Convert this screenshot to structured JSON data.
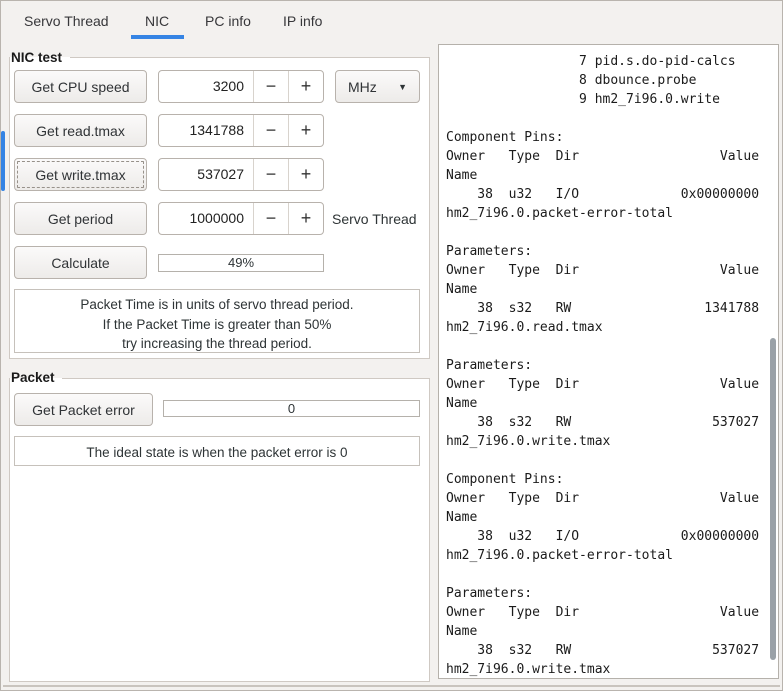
{
  "tabs": {
    "items": [
      {
        "label": "Servo Thread",
        "active": false
      },
      {
        "label": "NIC",
        "active": true
      },
      {
        "label": "PC info",
        "active": false
      },
      {
        "label": "IP info",
        "active": false
      }
    ]
  },
  "icons": {
    "minus": "−",
    "plus": "+",
    "dropdown": "▼"
  },
  "nic": {
    "title": "NIC test",
    "rows": [
      {
        "button": "Get CPU speed",
        "value": "3200",
        "unit": "MHz"
      },
      {
        "button": "Get read.tmax",
        "value": "1341788"
      },
      {
        "button": "Get write.tmax",
        "value": "537027"
      },
      {
        "button": "Get period",
        "value": "1000000",
        "side_label": "Servo Thread"
      }
    ],
    "calculate": "Calculate",
    "progress": "49%",
    "note": [
      "Packet Time is in units of servo thread period.",
      "If the Packet Time is greater than 50%",
      "try increasing the thread period."
    ]
  },
  "packet": {
    "title": "Packet",
    "button": "Get Packet error",
    "value": "0",
    "note": "The ideal state is when the packet error is 0"
  },
  "output": {
    "lines": [
      "                 7 pid.s.do-pid-calcs",
      "                 8 dbounce.probe",
      "                 9 hm2_7i96.0.write",
      "",
      "Component Pins:",
      "Owner   Type  Dir                  Value",
      "Name",
      "    38  u32   I/O             0x00000000",
      "hm2_7i96.0.packet-error-total",
      "",
      "Parameters:",
      "Owner   Type  Dir                  Value",
      "Name",
      "    38  s32   RW                 1341788",
      "hm2_7i96.0.read.tmax",
      "",
      "Parameters:",
      "Owner   Type  Dir                  Value",
      "Name",
      "    38  s32   RW                  537027",
      "hm2_7i96.0.write.tmax",
      "",
      "Component Pins:",
      "Owner   Type  Dir                  Value",
      "Name",
      "    38  u32   I/O             0x00000000",
      "hm2_7i96.0.packet-error-total",
      "",
      "Parameters:",
      "Owner   Type  Dir                  Value",
      "Name",
      "    38  s32   RW                  537027",
      "hm2_7i96.0.write.tmax"
    ]
  },
  "colors": {
    "accent": "#3584e4",
    "window_bg": "#f3f1ef",
    "panel_bg": "#ffffff",
    "text": "#2e3436",
    "border": "#b8b2ac",
    "scrollbar_thumb": "#9aa1a7"
  }
}
